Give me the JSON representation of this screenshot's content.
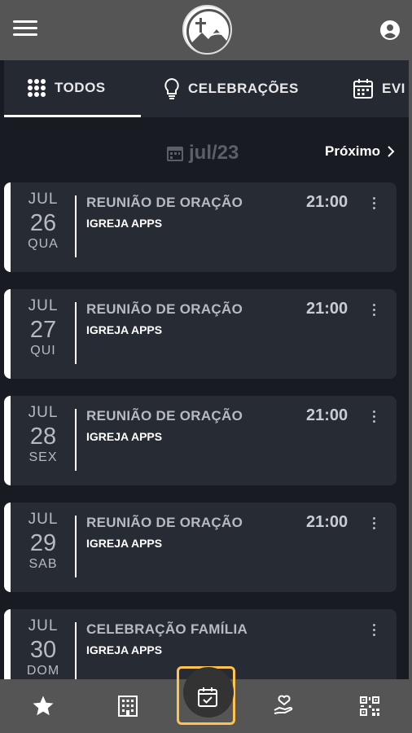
{
  "header": {
    "menu_icon": "hamburger-icon",
    "logo_icon": "church-logo",
    "profile_icon": "user-circle-icon"
  },
  "tabs": [
    {
      "label": "TODOS",
      "icon": "grid-dots-icon",
      "active": true
    },
    {
      "label": "CELEBRAÇÕES",
      "icon": "lightbulb-icon",
      "active": false
    },
    {
      "label": "EVI",
      "icon": "calendar-icon",
      "active": false
    }
  ],
  "month_nav": {
    "month_label": "jul/23",
    "next_label": "Próximo"
  },
  "events": [
    {
      "month": "JUL",
      "day": "26",
      "weekday": "QUA",
      "title": "REUNIÃO DE ORAÇÃO",
      "org": "IGREJA APPS",
      "time": "21:00"
    },
    {
      "month": "JUL",
      "day": "27",
      "weekday": "QUI",
      "title": "REUNIÃO DE ORAÇÃO",
      "org": "IGREJA APPS",
      "time": "21:00"
    },
    {
      "month": "JUL",
      "day": "28",
      "weekday": "SEX",
      "title": "REUNIÃO DE ORAÇÃO",
      "org": "IGREJA APPS",
      "time": "21:00"
    },
    {
      "month": "JUL",
      "day": "29",
      "weekday": "SAB",
      "title": "REUNIÃO DE ORAÇÃO",
      "org": "IGREJA APPS",
      "time": "21:00"
    },
    {
      "month": "JUL",
      "day": "30",
      "weekday": "DOM",
      "title": "CELEBRAÇÃO FAMÍLIA",
      "org": "IGREJA APPS",
      "time": ""
    }
  ],
  "bottom_nav": [
    {
      "icon": "star-icon"
    },
    {
      "icon": "building-icon"
    },
    {
      "icon": "calendar-check-icon",
      "active": true
    },
    {
      "icon": "hand-heart-icon"
    },
    {
      "icon": "qr-code-icon"
    }
  ],
  "colors": {
    "background": "#181b22",
    "card": "#272b34",
    "accent": "#ffc24d",
    "bar": "#555555"
  }
}
